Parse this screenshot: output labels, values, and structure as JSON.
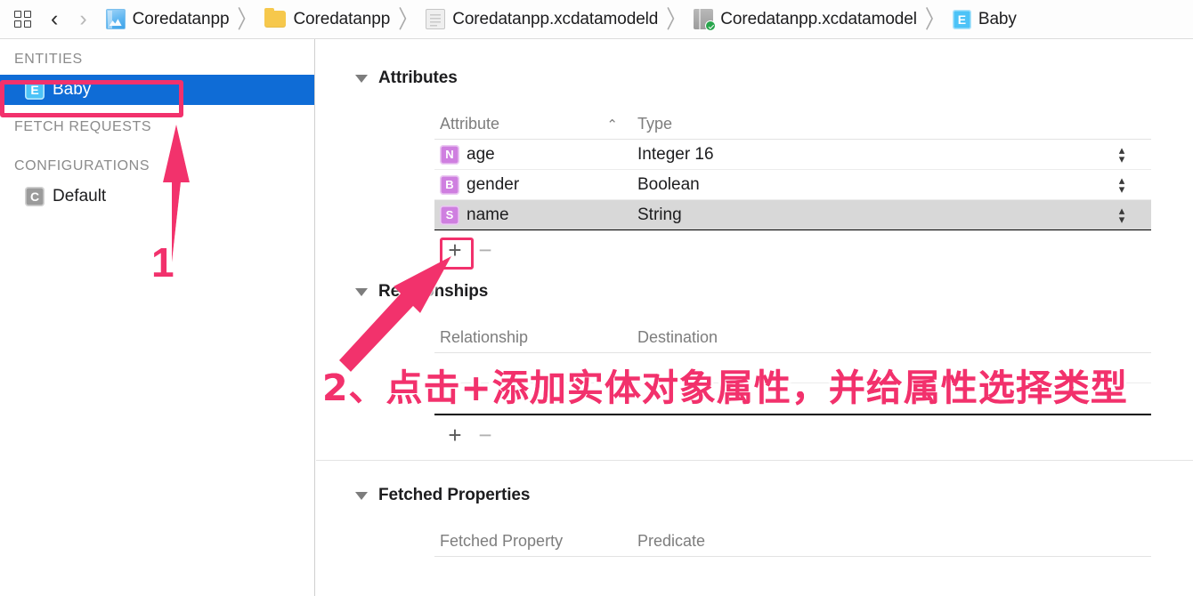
{
  "toolbar": {
    "grid_icon": "grid-icon",
    "back_icon": "chevron-left-icon",
    "forward_icon": "chevron-right-icon",
    "back_glyph": "‹",
    "forward_glyph": "›",
    "separator": "〉",
    "breadcrumbs": [
      {
        "label": "Coredatanpp",
        "icon": "xcode-project-icon"
      },
      {
        "label": "Coredatanpp",
        "icon": "folder-icon"
      },
      {
        "label": "Coredatanpp.xcdatamodeld",
        "icon": "xcdatamodeld-icon"
      },
      {
        "label": "Coredatanpp.xcdatamodel",
        "icon": "xcdatamodel-icon"
      },
      {
        "label": "Baby",
        "icon": "entity-icon",
        "badge": "E"
      }
    ]
  },
  "sidebar": {
    "sections": [
      {
        "header": "ENTITIES",
        "items": [
          {
            "label": "Baby",
            "badge": "E",
            "badge_kind": "entity",
            "selected": true
          }
        ]
      },
      {
        "header": "FETCH REQUESTS",
        "items": []
      },
      {
        "header": "CONFIGURATIONS",
        "items": [
          {
            "label": "Default",
            "badge": "C",
            "badge_kind": "config",
            "selected": false
          }
        ]
      }
    ]
  },
  "editor": {
    "attributes": {
      "title": "Attributes",
      "columns": {
        "name": "Attribute",
        "type": "Type"
      },
      "sort_indicator": "⌃",
      "rows": [
        {
          "badge": "N",
          "name": "age",
          "type": "Integer 16",
          "selected": false
        },
        {
          "badge": "B",
          "name": "gender",
          "type": "Boolean",
          "selected": false
        },
        {
          "badge": "S",
          "name": "name",
          "type": "String",
          "selected": true
        }
      ],
      "add_label": "+",
      "remove_label": "−"
    },
    "relationships": {
      "title": "Relationships",
      "columns": {
        "name": "Relationship",
        "destination": "Destination"
      },
      "rows": [],
      "add_label": "+",
      "remove_label": "−"
    },
    "fetched_properties": {
      "title": "Fetched Properties",
      "columns": {
        "name": "Fetched Property",
        "predicate": "Predicate"
      }
    }
  },
  "annotations": {
    "accent_color": "#F2316C",
    "step1": {
      "number": "1",
      "target": "sidebar-item-baby"
    },
    "step2": {
      "text": "2、点击+添加实体对象属性，并给属性选择类型",
      "target": "attributes-add-button"
    }
  }
}
